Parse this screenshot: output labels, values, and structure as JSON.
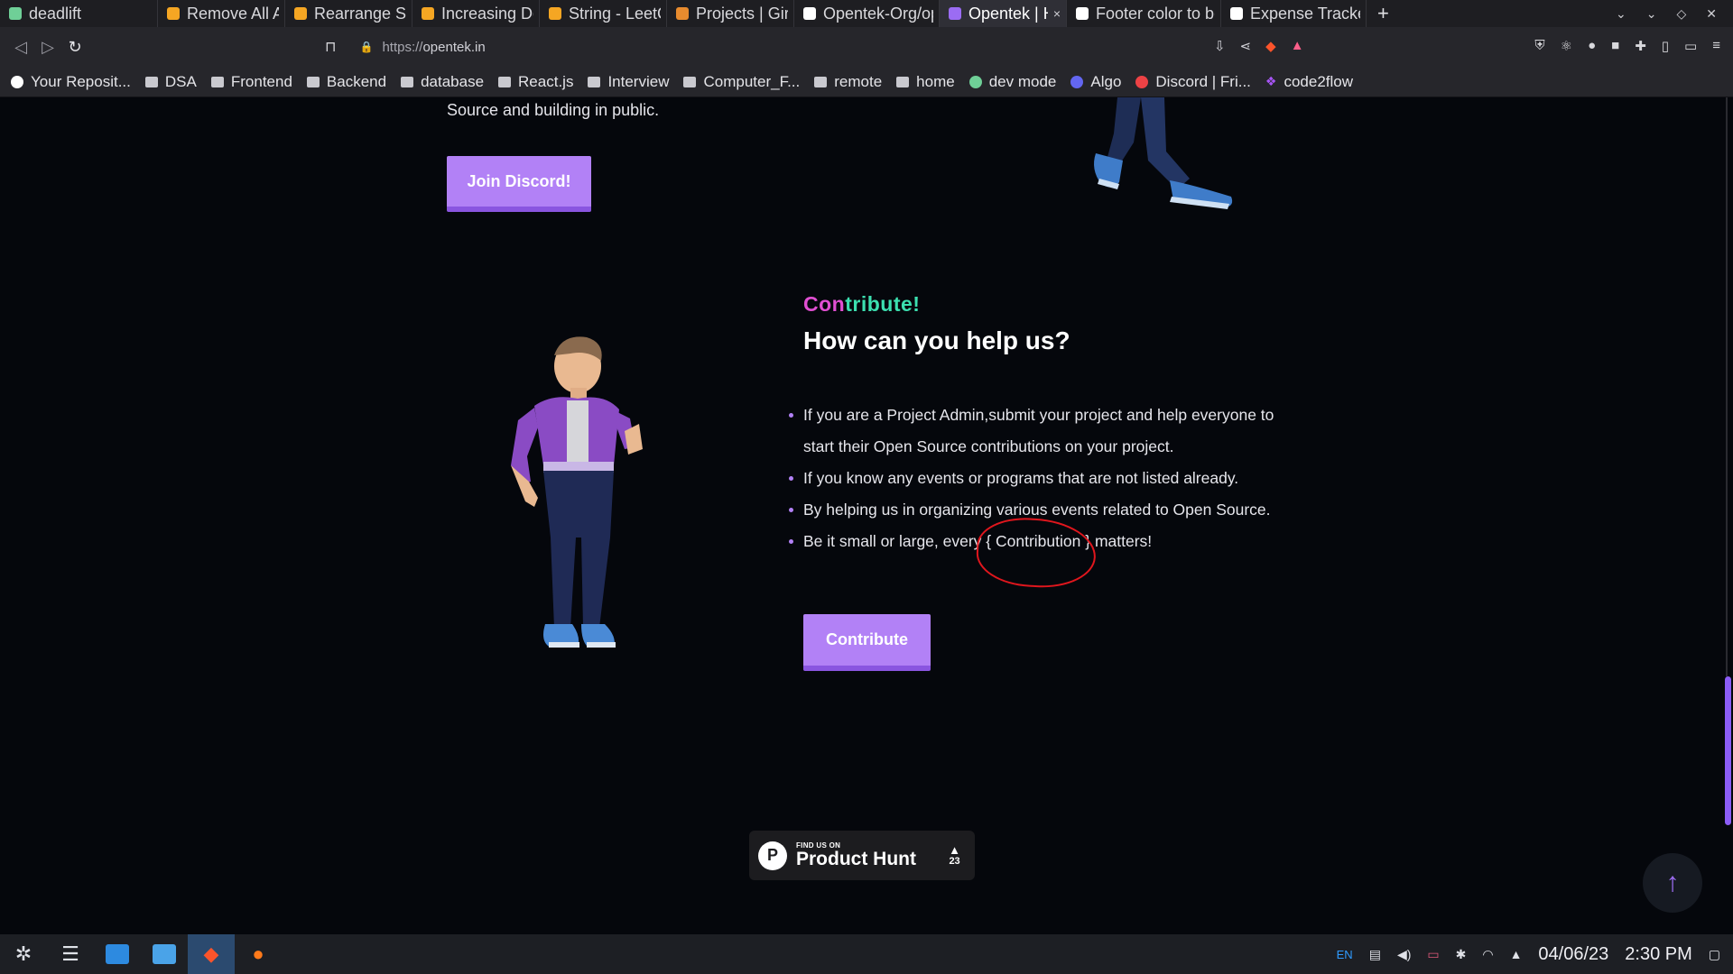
{
  "browser": {
    "tabs": [
      {
        "label": "deadlift",
        "fav_color": "#6fcf97",
        "active": false,
        "width": 140
      },
      {
        "label": "Remove All Adjac",
        "fav_color": "#f5a623",
        "active": false,
        "width": 140
      },
      {
        "label": "Rearrange Space",
        "fav_color": "#f5a623",
        "active": false,
        "width": 140
      },
      {
        "label": "Increasing Decre",
        "fav_color": "#f5a623",
        "active": false,
        "width": 140
      },
      {
        "label": "String - LeetCode",
        "fav_color": "#f5a623",
        "active": false,
        "width": 140
      },
      {
        "label": "Projects | GirlScri",
        "fav_color": "#e88b2e",
        "active": false,
        "width": 140
      },
      {
        "label": "Opentek-Org/ope",
        "fav_color": "#ffffff",
        "active": false,
        "width": 140
      },
      {
        "label": "Opentek | Hon",
        "fav_color": "#9b6cf3",
        "active": true,
        "width": 140
      },
      {
        "label": "Footer color to be",
        "fav_color": "#ffffff",
        "active": false,
        "width": 140
      },
      {
        "label": "Expense Tracker",
        "fav_color": "#ffffff",
        "active": false,
        "width": 140
      }
    ],
    "new_tab": "+",
    "tab_close": "×",
    "url_scheme": "https://",
    "url_host": "opentek.in",
    "bookmarks": [
      {
        "label": "Your Reposit...",
        "icon": "github-icon",
        "kind": "gh"
      },
      {
        "label": "DSA",
        "icon": "folder-icon",
        "kind": "folder"
      },
      {
        "label": "Frontend",
        "icon": "folder-icon",
        "kind": "folder"
      },
      {
        "label": "Backend",
        "icon": "folder-icon",
        "kind": "folder"
      },
      {
        "label": "database",
        "icon": "folder-icon",
        "kind": "folder"
      },
      {
        "label": "React.js",
        "icon": "folder-icon",
        "kind": "folder"
      },
      {
        "label": "Interview",
        "icon": "folder-icon",
        "kind": "folder"
      },
      {
        "label": "Computer_F...",
        "icon": "folder-icon",
        "kind": "folder"
      },
      {
        "label": "remote",
        "icon": "folder-icon",
        "kind": "folder"
      },
      {
        "label": "home",
        "icon": "folder-icon",
        "kind": "folder"
      },
      {
        "label": "dev mode",
        "icon": "devmode-icon",
        "kind": "devmode"
      },
      {
        "label": "Algo",
        "icon": "algo-icon",
        "kind": "algo"
      },
      {
        "label": "Discord | Fri...",
        "icon": "discord-icon",
        "kind": "discord"
      },
      {
        "label": "code2flow",
        "icon": "code2flow-icon",
        "kind": "c2f"
      }
    ]
  },
  "page": {
    "intro_tail": "Source and building in public.",
    "join_button": "Join Discord!",
    "eyebrow_a": "Con",
    "eyebrow_b": "tribute!",
    "heading": "How can you help us?",
    "points": [
      "If you are a Project Admin,submit your project and help everyone to start their Open Source contributions on your project.",
      "If you know any events or programs that are not listed already.",
      "By helping us in organizing various events related to Open Source."
    ],
    "last_point_before": "Be it small or large, every ",
    "last_point_mark": "{ Contribution }",
    "last_point_after": " matters!",
    "contribute_button": "Contribute",
    "product_hunt": {
      "small": "FIND US ON",
      "big": "Product Hunt",
      "logo_letter": "P",
      "votes": "23"
    },
    "scroll_top_glyph": "↑"
  },
  "taskbar": {
    "lang": "EN",
    "date": "04/06/23",
    "time": "2:30 PM"
  },
  "colors": {
    "accent_purple": "#b281f6",
    "eyebrow_pink": "#e14fd2",
    "eyebrow_teal": "#3ce0b0",
    "annotation_red": "#e0161d",
    "page_bg": "#05070c"
  }
}
